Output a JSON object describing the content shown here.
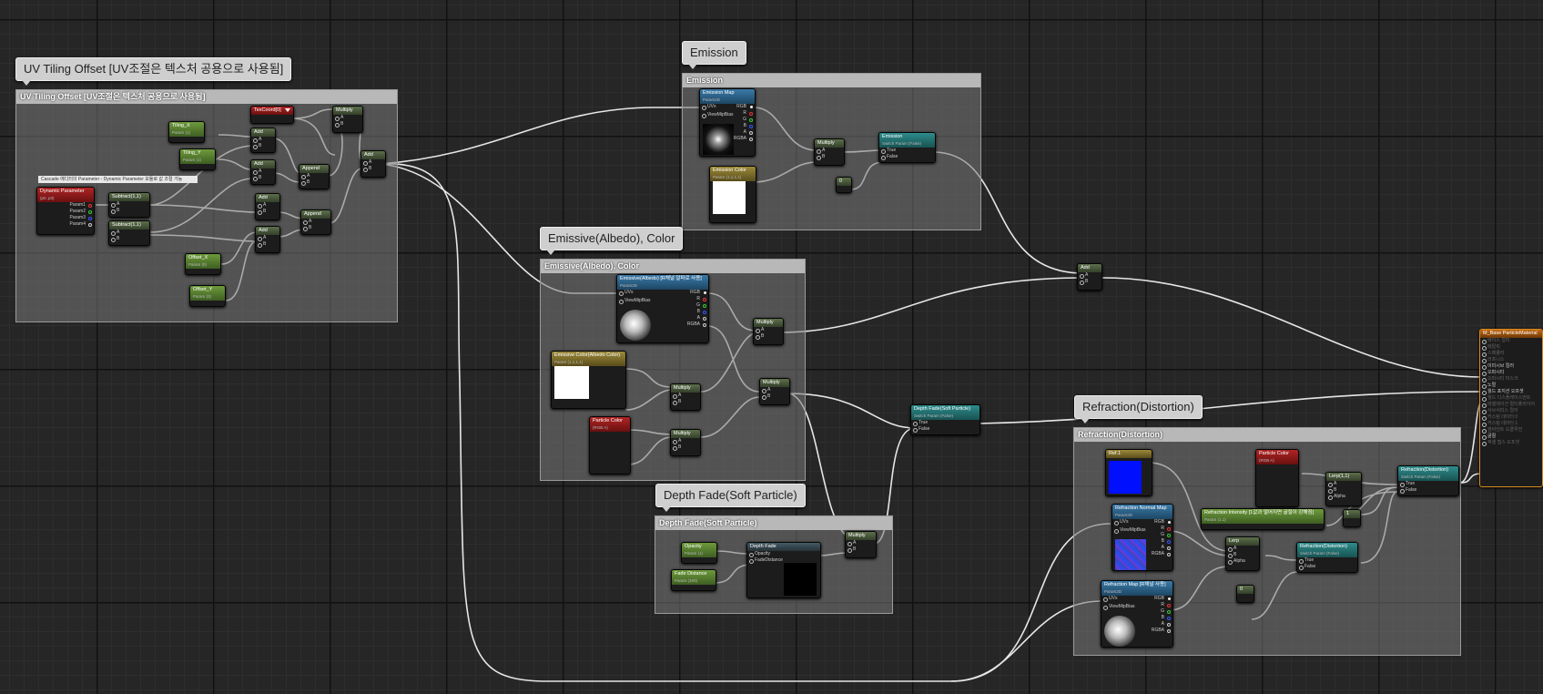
{
  "comments": {
    "uv": {
      "bubble": "UV Tiling Offset [UV조절은 텍스처 공용으로 사용됨]",
      "header": "UV Tiling Offset [UV조절은 텍스처 공용으로 사용됨]"
    },
    "emission": {
      "bubble": "Emission",
      "header": "Emission"
    },
    "emissive": {
      "bubble": "Emissive(Albedo), Color",
      "header": "Emissive(Albedo), Color"
    },
    "depth": {
      "bubble": "Depth Fade(Soft Particle)",
      "header": "Depth Fade(Soft Particle)"
    },
    "refraction": {
      "bubble": "Refraction(Distortion)",
      "header": "Refraction(Distortion)"
    }
  },
  "nodes": {
    "texcoord": {
      "title": "TexCoord[0]"
    },
    "tiling_x": {
      "title": "Tiling_X",
      "sub": "Param (1)"
    },
    "tiling_y": {
      "title": "Tiling_Y",
      "sub": "Param (1)"
    },
    "offset_x": {
      "title": "Offset_X",
      "sub": "Param (0)"
    },
    "offset_y": {
      "title": "Offset_Y",
      "sub": "Param (0)"
    },
    "cascade_note": {
      "text": "Cascade 에디터의 Parameter - Dynamic Parameter 모듈로 값 조절 가능"
    },
    "dynamic_param": {
      "title": "Dynamic Parameter",
      "sub": "(p0..p3)",
      "pins": [
        "Param1",
        "Param2",
        "Param3",
        "Param4"
      ]
    },
    "subtract1": {
      "title": "Subtract(1,1)"
    },
    "subtract2": {
      "title": "Subtract(1,1)"
    },
    "add": "Add",
    "append": "Append",
    "multiply": "Multiply",
    "pin_a": "A",
    "pin_b": "B",
    "emission_map": {
      "title": "Emission Map",
      "sub": "Param2D",
      "in": [
        "UVs",
        "ViewMipBias"
      ],
      "out": [
        "RGB",
        "R",
        "G",
        "B",
        "A",
        "RGBA"
      ]
    },
    "emission_color": {
      "title": "Emission Color",
      "sub": "Param (1,1,1,1)"
    },
    "emission_switch": {
      "title": "Emission",
      "sub": "Switch Param (False)",
      "pins": [
        "True",
        "False"
      ]
    },
    "const_zero": {
      "title": "0"
    },
    "emissive_albedo": {
      "title": "Emissive(Albedo) [R채널 알파로 사용]",
      "sub": "Param2D",
      "in": [
        "UVs",
        "ViewMipBias"
      ],
      "out": [
        "RGB",
        "R",
        "G",
        "B",
        "A",
        "RGBA"
      ]
    },
    "emissive_color": {
      "title": "Emissive Color(Albedo Color)",
      "sub": "Param (1,1,1,1)"
    },
    "particle_color": {
      "title": "Particle Color",
      "sub": "(RGB A)"
    },
    "depthfade_switch": {
      "title": "Depth Fade(Soft Particle)",
      "sub": "Switch Param (False)",
      "pins": [
        "True",
        "False"
      ]
    },
    "opacity": {
      "title": "Opacity",
      "sub": "Param (1)"
    },
    "fade_distance": {
      "title": "Fade Distance",
      "sub": "Param (100)"
    },
    "depth_fade": {
      "title": "Depth Fade",
      "in": [
        "Opacity",
        "FadeDistance"
      ]
    },
    "refraction_color": {
      "title": "Ref.1"
    },
    "particle_color2": {
      "title": "Particle Color",
      "sub": "(RGB A)"
    },
    "lerp_1": {
      "title": "Lerp(1,1)",
      "pins": [
        "A",
        "B",
        "Alpha"
      ]
    },
    "lerp": {
      "title": "Lerp",
      "pins": [
        "A",
        "B",
        "Alpha"
      ]
    },
    "const_one": {
      "title": "1"
    },
    "const_zero2": {
      "title": "0"
    },
    "refraction_intensity": {
      "title": "Refraction Intensity [1값과 멀어지면 굴절이 강해짐]",
      "sub": "Param (1.1)"
    },
    "refraction_normal": {
      "title": "Refraction Normal Map",
      "sub": "Param2D",
      "in": [
        "UVs",
        "ViewMipBias"
      ],
      "out": [
        "RGB",
        "R",
        "G",
        "B",
        "A",
        "RGBA"
      ]
    },
    "refraction_map": {
      "title": "Refraction Map [R채널 사용]",
      "sub": "Param2D",
      "in": [
        "UVs",
        "ViewMipBias"
      ],
      "out": [
        "RGB",
        "R",
        "G",
        "B",
        "A",
        "RGBA"
      ]
    },
    "refraction_switch1": {
      "title": "Refraction(Distortion)",
      "sub": "Switch Param (False)",
      "pins": [
        "True",
        "False"
      ]
    },
    "refraction_switch2": {
      "title": "Refraction(Distortion)",
      "sub": "Switch Param (False)",
      "pins": [
        "True",
        "False"
      ]
    },
    "result": {
      "title": "M_Base ParticleMaterial",
      "pins": [
        "베이스 컬러",
        "메탈릭",
        "스페큘러",
        "러프니스",
        "이미시브 컬러",
        "오파시티",
        "오파시티 마스크",
        "노멀",
        "월드 포지션 오프셋",
        "월드 디스플레이스먼트",
        "테셀레이션 멀티플라이어",
        "서브서피스 컬러",
        "커스텀 데이터 0",
        "커스텀 데이터 1",
        "앰비언트 오클루전",
        "굴절",
        "픽셀 뎁스 오프셋"
      ]
    }
  },
  "colors": {
    "accent_orange": "#d98a1c",
    "param_green": "#6d9a3c",
    "texture_blue": "#3b7aa8",
    "switch_teal": "#2f8c8c",
    "vector_gold": "#9c8a3a",
    "particle_red": "#b02424"
  }
}
